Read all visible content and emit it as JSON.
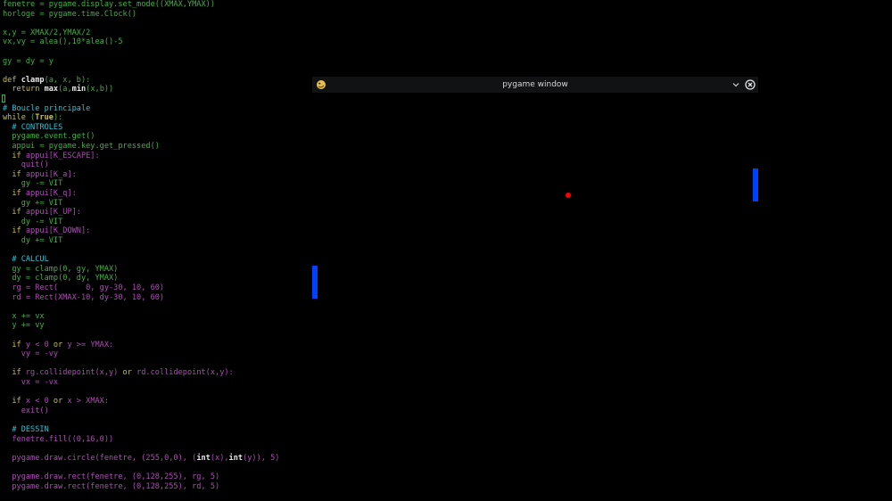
{
  "editor": {
    "lines": [
      [
        {
          "t": "fenetre = pygame.display.set_mode((XMAX,YMAX))",
          "c": "g"
        }
      ],
      [
        {
          "t": "horloge = pygame.time.Clock()",
          "c": "g"
        }
      ],
      [],
      [
        {
          "t": "x,y = XMAX/2,YMAX/2",
          "c": "g"
        }
      ],
      [
        {
          "t": "vx,vy = alea(),10*alea()-5",
          "c": "g"
        }
      ],
      [],
      [
        {
          "t": "gy = dy = y",
          "c": "g"
        }
      ],
      [],
      [
        {
          "t": "def ",
          "c": "kw"
        },
        {
          "t": "clamp",
          "c": "fn"
        },
        {
          "t": "(a, x, b):",
          "c": "g"
        }
      ],
      [
        {
          "t": "  return ",
          "c": "kw"
        },
        {
          "t": "max",
          "c": "fn"
        },
        {
          "t": "(a,",
          "c": "g"
        },
        {
          "t": "min",
          "c": "fn"
        },
        {
          "t": "(x,b))",
          "c": "g"
        }
      ],
      [],
      [
        {
          "t": "# Boucle principale",
          "c": "c"
        }
      ],
      [
        {
          "t": "while ",
          "c": "kw"
        },
        {
          "t": "(",
          "c": "g"
        },
        {
          "t": "True",
          "c": "kw2"
        },
        {
          "t": "):",
          "c": "g"
        }
      ],
      [
        {
          "t": "  # CONTROLES",
          "c": "c"
        }
      ],
      [
        {
          "t": "  pygame.event.get()",
          "c": "g"
        }
      ],
      [
        {
          "t": "  appui = pygame.key.get_pressed()",
          "c": "g"
        }
      ],
      [
        {
          "t": "  if ",
          "c": "kw"
        },
        {
          "t": "appui[K_ESCAPE]:",
          "c": "p"
        }
      ],
      [
        {
          "t": "    quit()",
          "c": "p"
        }
      ],
      [
        {
          "t": "  if ",
          "c": "kw"
        },
        {
          "t": "appui[K_a]:",
          "c": "p"
        }
      ],
      [
        {
          "t": "    gy -= VIT",
          "c": "g"
        }
      ],
      [
        {
          "t": "  if ",
          "c": "kw"
        },
        {
          "t": "appui[K_q]:",
          "c": "p"
        }
      ],
      [
        {
          "t": "    gy += VIT",
          "c": "g"
        }
      ],
      [
        {
          "t": "  if ",
          "c": "kw"
        },
        {
          "t": "appui[K_UP]:",
          "c": "p"
        }
      ],
      [
        {
          "t": "    dy -= VIT",
          "c": "g"
        }
      ],
      [
        {
          "t": "  if ",
          "c": "kw"
        },
        {
          "t": "appui[K_DOWN]:",
          "c": "p"
        }
      ],
      [
        {
          "t": "    dy += VIT",
          "c": "g"
        }
      ],
      [],
      [
        {
          "t": "  # CALCUL",
          "c": "c"
        }
      ],
      [
        {
          "t": "  gy = clamp(0, gy, YMAX)",
          "c": "g"
        }
      ],
      [
        {
          "t": "  dy = clamp(0, dy, YMAX)",
          "c": "g"
        }
      ],
      [
        {
          "t": "  rg = Rect(      0, gy-30, 10, 60)",
          "c": "p"
        }
      ],
      [
        {
          "t": "  rd = Rect(XMAX-10, dy-30, 10, 60)",
          "c": "p"
        }
      ],
      [],
      [
        {
          "t": "  x += vx",
          "c": "g"
        }
      ],
      [
        {
          "t": "  y += vy",
          "c": "g"
        }
      ],
      [],
      [
        {
          "t": "  if ",
          "c": "kw"
        },
        {
          "t": "y < 0 ",
          "c": "p"
        },
        {
          "t": "or ",
          "c": "kw"
        },
        {
          "t": "y >= YMAX:",
          "c": "p"
        }
      ],
      [
        {
          "t": "    vy = -vy",
          "c": "p"
        }
      ],
      [],
      [
        {
          "t": "  if ",
          "c": "kw"
        },
        {
          "t": "rg.collidepoint(x,y) ",
          "c": "p"
        },
        {
          "t": "or ",
          "c": "kw"
        },
        {
          "t": "rd.collidepoint(x,y):",
          "c": "p"
        }
      ],
      [
        {
          "t": "    vx = -vx",
          "c": "p"
        }
      ],
      [],
      [
        {
          "t": "  if ",
          "c": "kw"
        },
        {
          "t": "x < 0 ",
          "c": "p"
        },
        {
          "t": "or ",
          "c": "kw"
        },
        {
          "t": "x > XMAX:",
          "c": "p"
        }
      ],
      [
        {
          "t": "    exit()",
          "c": "p"
        }
      ],
      [],
      [
        {
          "t": "  # DESSIN",
          "c": "c"
        }
      ],
      [
        {
          "t": "  fenetre.fill((0,16,0))",
          "c": "p"
        }
      ],
      [],
      [
        {
          "t": "  pygame.draw.circle(fenetre, (255,0,0), (",
          "c": "p"
        },
        {
          "t": "int",
          "c": "fn"
        },
        {
          "t": "(x),",
          "c": "p"
        },
        {
          "t": "int",
          "c": "fn"
        },
        {
          "t": "(y)), 5)",
          "c": "p"
        }
      ],
      [],
      [
        {
          "t": "  pygame.draw.rect(fenetre, (0,128,255), rg, 5)",
          "c": "p"
        }
      ],
      [
        {
          "t": "  pygame.draw.rect(fenetre, (0,128,255), rd, 5)",
          "c": "p"
        }
      ]
    ]
  },
  "window": {
    "title": "pygame window",
    "icon": "pygame-snake-icon",
    "chevron_icon": "chevron-down-icon",
    "close_icon": "close-icon"
  },
  "game": {
    "background": "#000000",
    "paddle_color": "#0040ff",
    "ball_color": "#ff0000"
  }
}
